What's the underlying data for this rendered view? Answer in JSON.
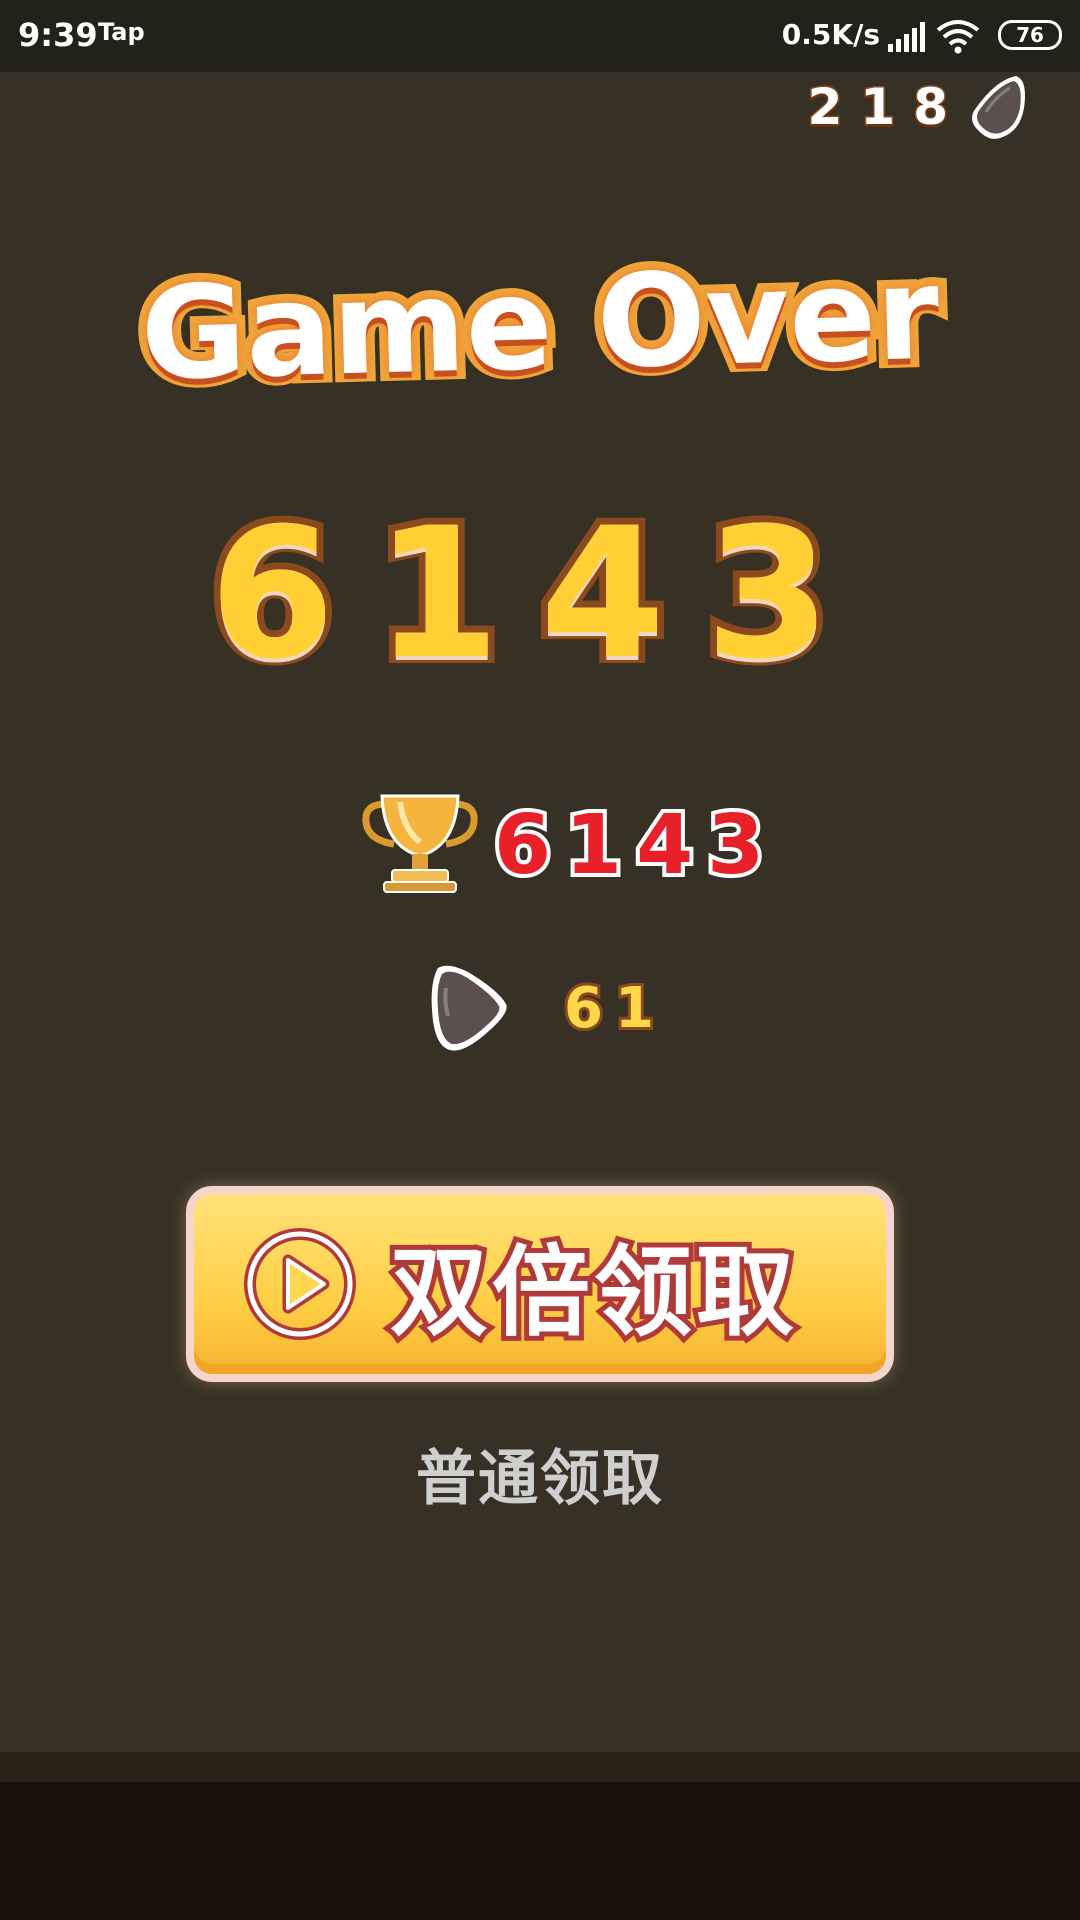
{
  "status_bar": {
    "time": "9:39",
    "app_label": "Tap",
    "network_speed": "0.5K/s",
    "battery_level": "76"
  },
  "hud": {
    "coin_total": "218"
  },
  "result": {
    "title": "Game Over",
    "score": "6143",
    "best_score": "6143",
    "reward": "61"
  },
  "actions": {
    "double_claim_label": "双倍领取",
    "normal_claim_label": "普通领取"
  },
  "colors": {
    "background": "#363124",
    "score_fill": "#ffcf33",
    "best_score_fill": "#e8202a",
    "button_fill": "#ffcf45",
    "button_text_stroke": "#b03a3a"
  },
  "icons": [
    "signal-icon",
    "wifi-icon",
    "battery-icon",
    "pick-icon",
    "trophy-icon",
    "play-icon"
  ]
}
